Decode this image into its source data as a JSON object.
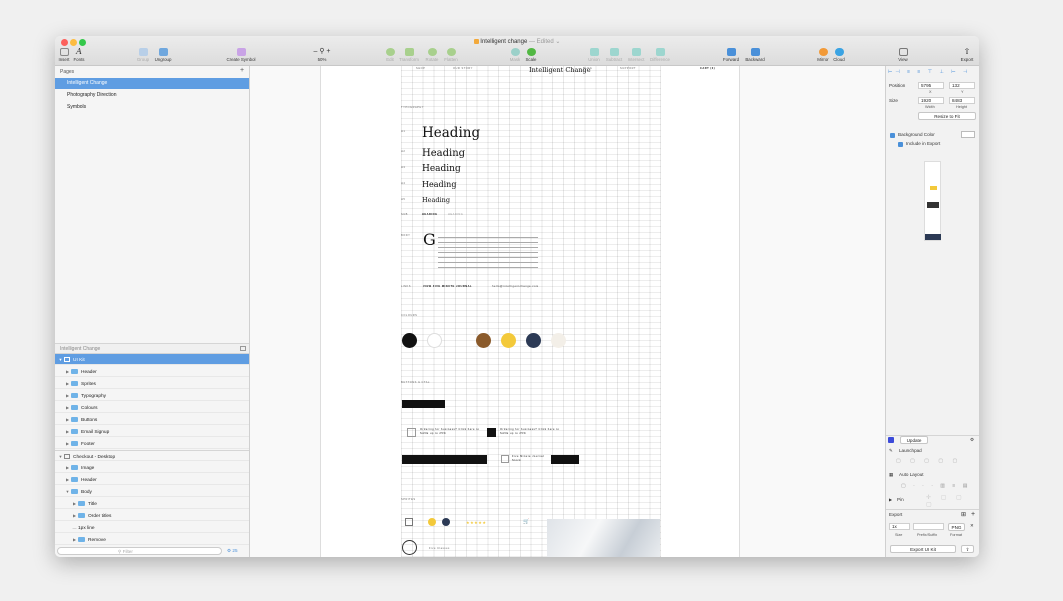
{
  "window": {
    "title": "Intelligent change",
    "edited": "— Edited ⌄"
  },
  "toolbar": {
    "insert": "Insert",
    "fonts": "Fonts",
    "group": "Group",
    "ungroup": "Ungroup",
    "create_symbol": "Create Symbol",
    "zoom": "50%",
    "edit": "Edit",
    "transform": "Transform",
    "rotate": "Rotate",
    "flatten": "Flatten",
    "mask": "Mask",
    "scale": "Scale",
    "union": "Union",
    "subtract": "Subtract",
    "intersect": "Intersect",
    "difference": "Difference",
    "forward": "Forward",
    "backward": "Backward",
    "mirror": "Mirror",
    "cloud": "Cloud",
    "view": "View",
    "export": "Export"
  },
  "pages": {
    "header": "Pages",
    "items": [
      "Intelligent Change",
      "Photography Direction",
      "Symbols"
    ]
  },
  "layers": {
    "page_name": "Intelligent Change",
    "items": [
      {
        "label": "UI Kit"
      },
      {
        "label": "Header"
      },
      {
        "label": "Sprites"
      },
      {
        "label": "Typography"
      },
      {
        "label": "Colours"
      },
      {
        "label": "Buttons"
      },
      {
        "label": "Email Signup"
      },
      {
        "label": "Footer"
      },
      {
        "label": "Checkout - Desktop"
      },
      {
        "label": "Image"
      },
      {
        "label": "Header"
      },
      {
        "label": "Body"
      },
      {
        "label": "Title"
      },
      {
        "label": "Order titles"
      },
      {
        "label": "1px line"
      },
      {
        "label": "Remove"
      }
    ],
    "filter_placeholder": "Filter",
    "count": "25"
  },
  "artboard": {
    "brand": "Intelligent Change",
    "nav": [
      "SHOP",
      "OUR STORY",
      "BLOG",
      "SUPPORT"
    ],
    "cart": "CART (3)",
    "section_typography": "TYPOGRAPHY",
    "heading": "Heading",
    "h_labels": [
      "H1",
      "H2",
      "H3",
      "H4",
      "H5"
    ],
    "sub_label": "SUB",
    "sub_text": "HEADING",
    "sub_text2": "HEADING",
    "body_label": "BODY",
    "dropcap": "G",
    "links_label": "LINKS",
    "link1": "VIEW FIVE MINUTE JOURNAL",
    "link2": "hello@intelligentchange.com",
    "section_colours": "COLOURS",
    "section_buttons": "BUTTONS & CTAs",
    "cta1": "Ordering for business? Click here to SAVE up to 25%",
    "cta2": "Ordering for business? Click here to SAVE up to 25%",
    "cta3": "Five Minute Journal Stock",
    "section_sprites": "SPRITES",
    "seal": "INTELLIGENT CHANGE",
    "caption": "Five Classes"
  },
  "inspector": {
    "position_label": "Position",
    "x": "5795",
    "y": "132",
    "x_lab": "X",
    "y_lab": "Y",
    "size_label": "Size",
    "width": "1920",
    "height": "8483",
    "w_lab": "Width",
    "h_lab": "Height",
    "resize_to_fit": "Resize to Fit",
    "bg_color": "Background Color",
    "include_export": "Include in Export",
    "update": "Update",
    "launchpad": "Launchpad",
    "auto_layout": "Auto Layout",
    "pin": "Pin",
    "export_header": "Export",
    "scale": "1x",
    "format": "PNG",
    "size_lab": "Size",
    "prefix_lab": "Prefix/Suffix",
    "format_lab": "Format",
    "export_btn": "Export UI Kit"
  },
  "colors": {
    "accent": "#5f9de2",
    "swatches": [
      "#111111",
      "#ffffff",
      "#8a5a2b",
      "#f3c93a",
      "#2c3a55",
      "#f3efe8"
    ]
  }
}
